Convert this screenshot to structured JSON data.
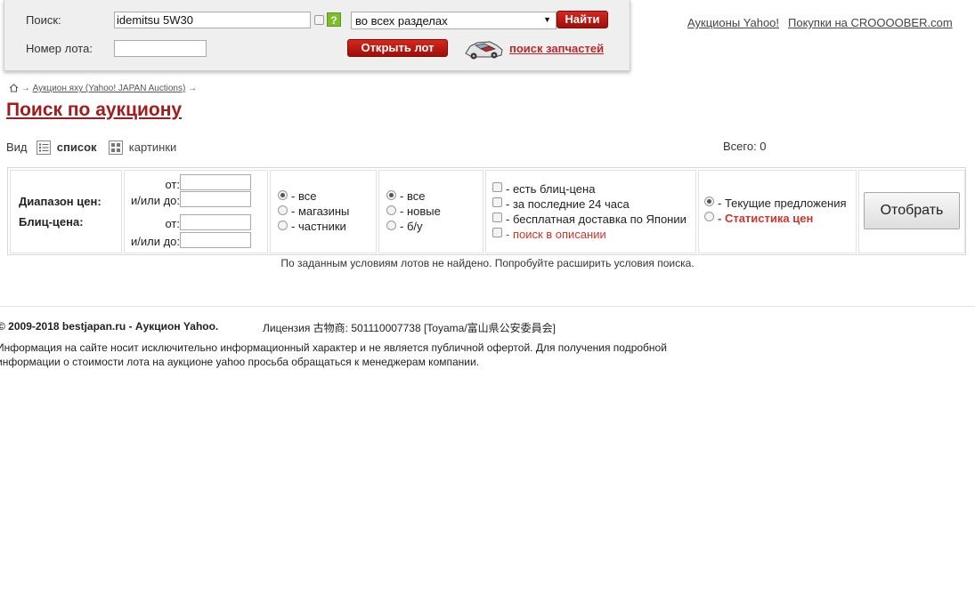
{
  "search": {
    "label": "Поиск:",
    "query": "idemitsu 5W30",
    "help": "?",
    "section": "во всех разделах",
    "find_button": "Найти",
    "lot_label": "Номер лота:",
    "lot_value": "",
    "open_lot_button": "Открыть лот",
    "parts_link": "поиск запчастей"
  },
  "top_links": {
    "yahoo": "Аукционы Yahoo!",
    "crooober": "Покупки на CROOOOBER.com"
  },
  "breadcrumb": {
    "arrow": "→",
    "item": "Аукцион яху (Yahoo! JAPAN Auctions)"
  },
  "page_title": "Поиск по аукциону",
  "view": {
    "label": "Вид",
    "list": "список",
    "pictures": "картинки",
    "total": "Всего: 0"
  },
  "filters": {
    "price_range_label": "Диапазон цен:",
    "blitz_label": "Блиц-цена:",
    "from": "от:",
    "to": "и/или до:",
    "seller": {
      "all": "- все",
      "shops": "- магазины",
      "private": "- частники"
    },
    "condition": {
      "all": "- все",
      "new": "- новые",
      "used": "- б/у"
    },
    "options": {
      "blitz": "- есть блиц-цена",
      "last24": "- за последние 24 часа",
      "free_shipping": "- бесплатная доставка по Японии",
      "desc_search": "- поиск в описании"
    },
    "mode": {
      "current": "- Текущие предложения",
      "stats": "- Статистика цен"
    },
    "submit": "Отобрать"
  },
  "no_results": "По заданным условиям лотов не найдено. Попробуйте расширить условия поиска.",
  "footer": {
    "copyright": "© 2009-2018 bestjapan.ru - Аукцион Yahoo.",
    "license": "Лицензия 古物商: 501110007738 [Toyama/富山県公安委員会]",
    "disclaimer": "Информация на сайте носит исключительно информационный характер и не является публичной офертой. Для получения подробной информации о стоимости лота на аукционе yahoo просьба обращаться к менеджерам компании."
  },
  "colors": {
    "brand_red": "#c0262c",
    "button_red": "#b8170f",
    "help_green": "#7cbd29"
  }
}
